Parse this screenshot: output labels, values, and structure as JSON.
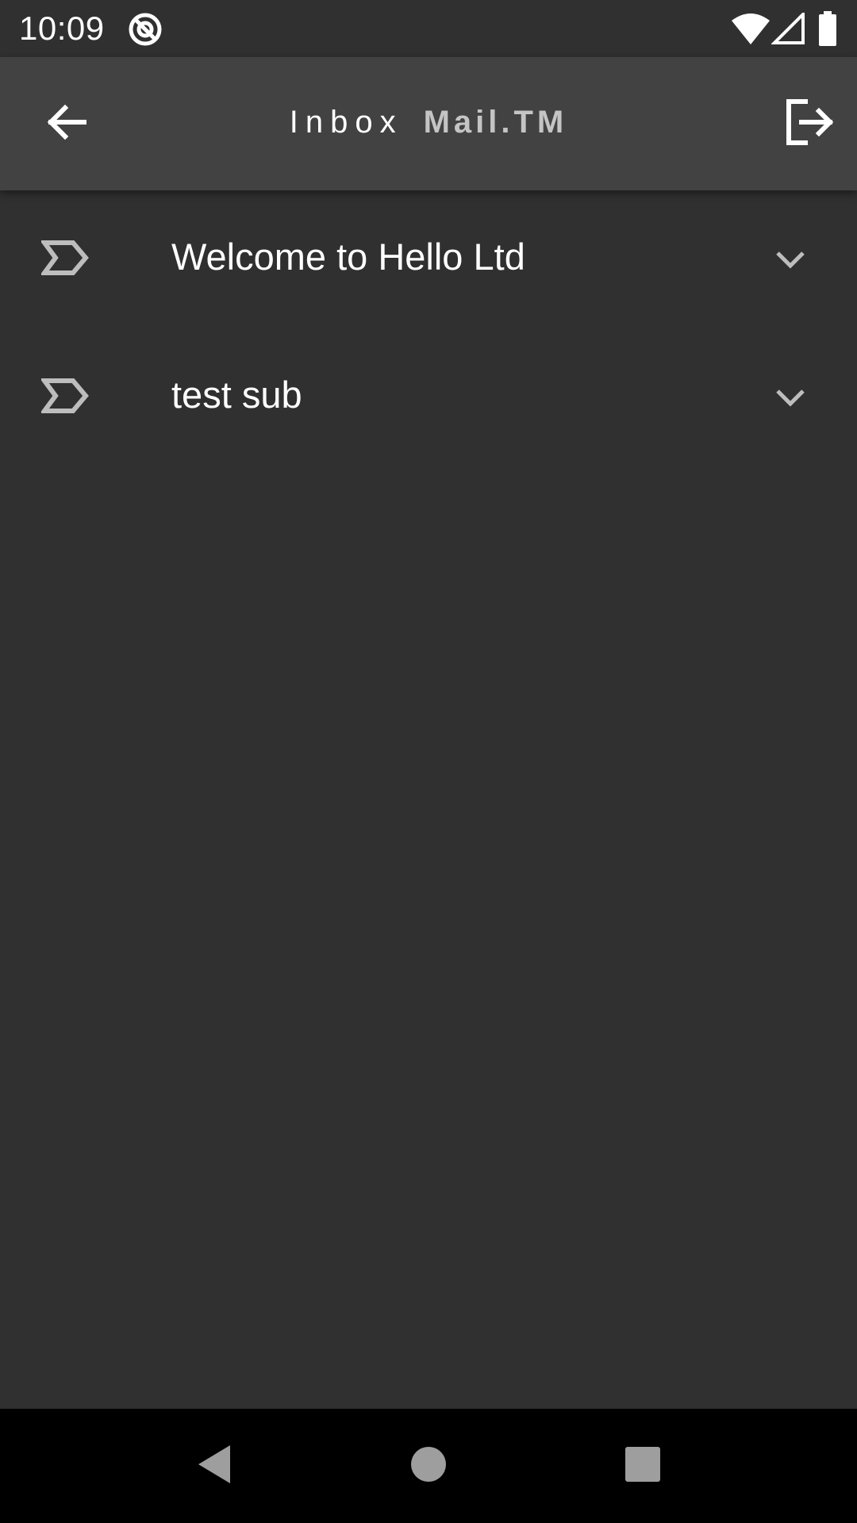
{
  "status_bar": {
    "time": "10:09",
    "icons": [
      "do-not-disturb-icon",
      "wifi-icon",
      "cellular-signal-icon",
      "battery-icon"
    ]
  },
  "app_bar": {
    "title": "Inbox",
    "brand": "Mail.TM",
    "back_icon": "arrow-back-icon",
    "logout_icon": "logout-icon"
  },
  "messages": [
    {
      "subject": "Welcome to Hello Ltd",
      "icon": "label-outline-icon",
      "expand_icon": "chevron-down-icon"
    },
    {
      "subject": "test sub",
      "icon": "label-outline-icon",
      "expand_icon": "chevron-down-icon"
    }
  ],
  "nav_bar": {
    "icons": [
      "nav-back-icon",
      "nav-home-icon",
      "nav-recents-icon"
    ]
  },
  "colors": {
    "background": "#303030",
    "app_bar": "#424242",
    "text_primary": "#ffffff",
    "text_brand": "#c4c4c4",
    "icon_muted": "#bdbdbd",
    "nav_bar": "#000000",
    "nav_icon": "#9e9e9e"
  }
}
